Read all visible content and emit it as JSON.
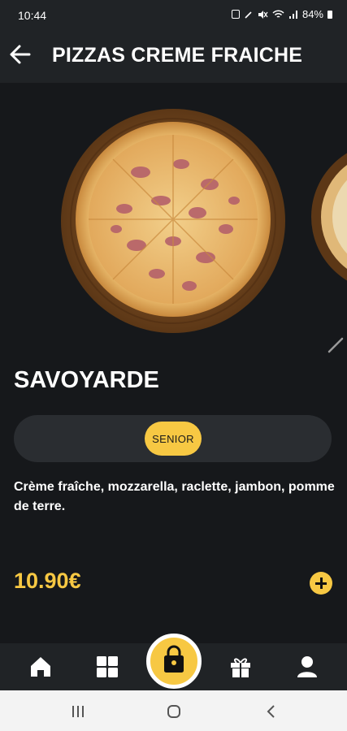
{
  "status_bar": {
    "time": "10:44",
    "battery": "84%"
  },
  "header": {
    "title": "PIZZAS CREME FRAICHE",
    "back_icon": "arrow-left-icon"
  },
  "product": {
    "name": "SAVOYARDE",
    "sizes": [
      {
        "label": "SENIOR",
        "selected": true
      }
    ],
    "description": "Crème fraîche, mozzarella, raclette, jambon, pomme de terre.",
    "price": "10.90€"
  },
  "bottom_nav": {
    "items": [
      {
        "icon": "home-icon"
      },
      {
        "icon": "grid-icon"
      },
      {
        "icon": "shopping-bag-icon",
        "center": true
      },
      {
        "icon": "gift-icon"
      },
      {
        "icon": "user-icon"
      }
    ]
  },
  "colors": {
    "accent": "#f7c843",
    "background": "#16181b",
    "header": "#202326",
    "chip_bar": "#2a2d31"
  }
}
